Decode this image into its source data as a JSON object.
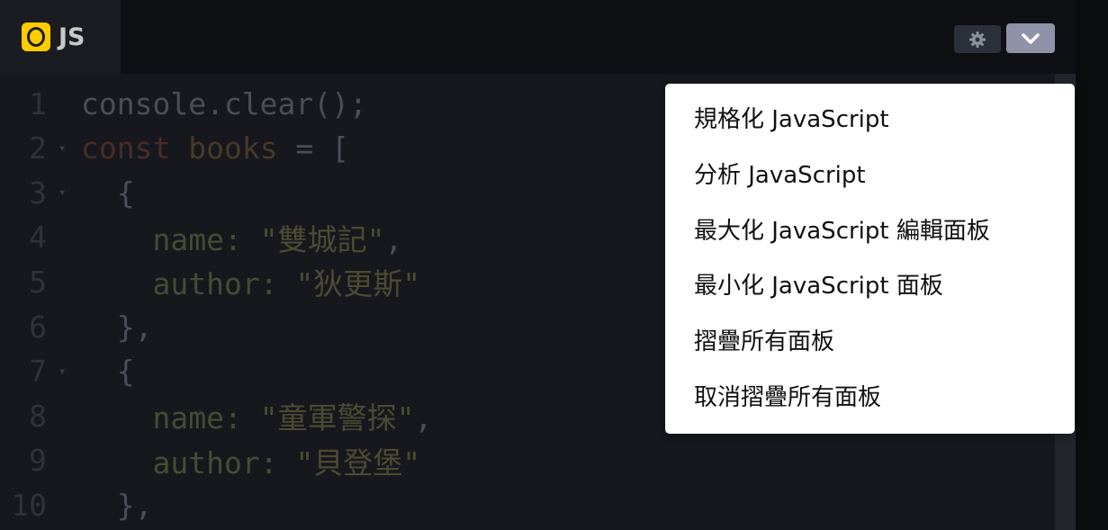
{
  "tab": {
    "label": "JS",
    "icon": "javascript-icon"
  },
  "toolbar": {
    "settings_icon": "gear-icon",
    "menu_icon": "chevron-down-icon"
  },
  "code_lines": [
    {
      "num": "1",
      "fold": "",
      "indent": "",
      "tokens": [
        {
          "t": "console.clear();",
          "c": "tok-plain"
        }
      ]
    },
    {
      "num": "2",
      "fold": "▾",
      "indent": "",
      "tokens": [
        {
          "t": "const",
          "c": "tok-kw"
        },
        {
          "t": " ",
          "c": "tok-plain"
        },
        {
          "t": "books",
          "c": "tok-var"
        },
        {
          "t": " = [",
          "c": "tok-plain"
        }
      ]
    },
    {
      "num": "3",
      "fold": "▾",
      "indent": "  ",
      "tokens": [
        {
          "t": "{",
          "c": "tok-plain"
        }
      ]
    },
    {
      "num": "4",
      "fold": "",
      "indent": "    ",
      "tokens": [
        {
          "t": "name:",
          "c": "tok-prop"
        },
        {
          "t": " ",
          "c": "tok-plain"
        },
        {
          "t": "\"雙城記\"",
          "c": "tok-str"
        },
        {
          "t": ",",
          "c": "tok-plain"
        }
      ]
    },
    {
      "num": "5",
      "fold": "",
      "indent": "    ",
      "tokens": [
        {
          "t": "author:",
          "c": "tok-prop"
        },
        {
          "t": " ",
          "c": "tok-plain"
        },
        {
          "t": "\"狄更斯\"",
          "c": "tok-str"
        }
      ]
    },
    {
      "num": "6",
      "fold": "",
      "indent": "  ",
      "tokens": [
        {
          "t": "},",
          "c": "tok-plain"
        }
      ]
    },
    {
      "num": "7",
      "fold": "▾",
      "indent": "  ",
      "tokens": [
        {
          "t": "{",
          "c": "tok-plain"
        }
      ]
    },
    {
      "num": "8",
      "fold": "",
      "indent": "    ",
      "tokens": [
        {
          "t": "name:",
          "c": "tok-prop"
        },
        {
          "t": " ",
          "c": "tok-plain"
        },
        {
          "t": "\"童軍警探\"",
          "c": "tok-str"
        },
        {
          "t": ",",
          "c": "tok-plain"
        }
      ]
    },
    {
      "num": "9",
      "fold": "",
      "indent": "    ",
      "tokens": [
        {
          "t": "author:",
          "c": "tok-prop"
        },
        {
          "t": " ",
          "c": "tok-plain"
        },
        {
          "t": "\"貝登堡\"",
          "c": "tok-str"
        }
      ]
    },
    {
      "num": "10",
      "fold": "",
      "indent": "  ",
      "tokens": [
        {
          "t": "},",
          "c": "tok-plain"
        }
      ]
    }
  ],
  "menu": {
    "items": [
      "規格化 JavaScript",
      "分析 JavaScript",
      "最大化 JavaScript 編輯面板",
      "最小化 JavaScript 面板",
      "摺疊所有面板",
      "取消摺疊所有面板"
    ]
  },
  "colors": {
    "accent_js": "#ffcc00",
    "menu_button": "#8f93a8",
    "editor_bg": "#16181d"
  }
}
